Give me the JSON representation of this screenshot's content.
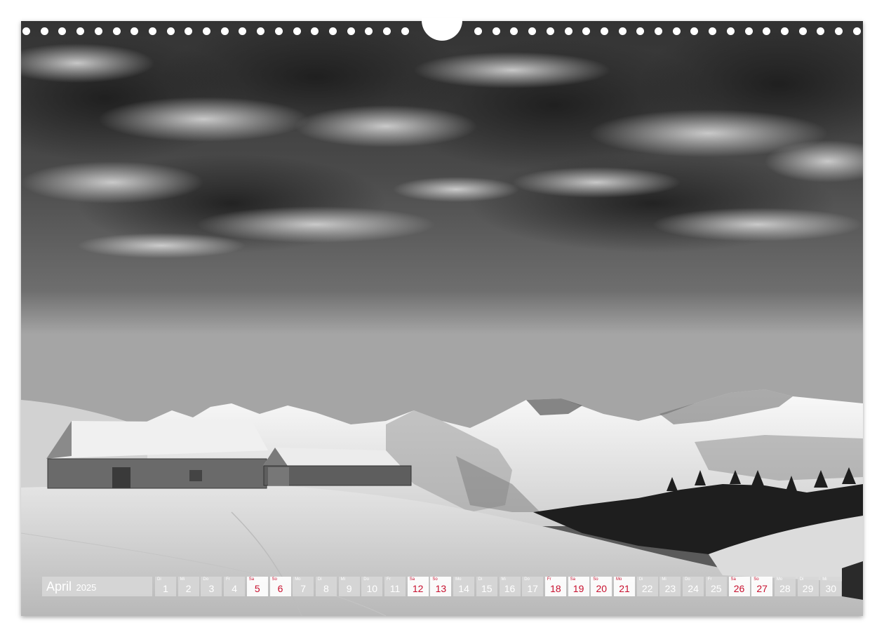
{
  "calendar": {
    "month": "April",
    "year": "2025",
    "colors": {
      "weekday_text": "#ffffff",
      "holiday_text": "#c8102e",
      "cell_bg": "#d7d7d7"
    },
    "days": [
      {
        "num": "1",
        "abbr": "Di",
        "red": false
      },
      {
        "num": "2",
        "abbr": "Mi",
        "red": false
      },
      {
        "num": "3",
        "abbr": "Do",
        "red": false
      },
      {
        "num": "4",
        "abbr": "Fr",
        "red": false
      },
      {
        "num": "5",
        "abbr": "Sa",
        "red": true
      },
      {
        "num": "6",
        "abbr": "So",
        "red": true
      },
      {
        "num": "7",
        "abbr": "Mo",
        "red": false
      },
      {
        "num": "8",
        "abbr": "Di",
        "red": false
      },
      {
        "num": "9",
        "abbr": "Mi",
        "red": false
      },
      {
        "num": "10",
        "abbr": "Do",
        "red": false
      },
      {
        "num": "11",
        "abbr": "Fr",
        "red": false
      },
      {
        "num": "12",
        "abbr": "Sa",
        "red": true
      },
      {
        "num": "13",
        "abbr": "So",
        "red": true
      },
      {
        "num": "14",
        "abbr": "Mo",
        "red": false
      },
      {
        "num": "15",
        "abbr": "Di",
        "red": false
      },
      {
        "num": "16",
        "abbr": "Mi",
        "red": false
      },
      {
        "num": "17",
        "abbr": "Do",
        "red": false
      },
      {
        "num": "18",
        "abbr": "Fr",
        "red": true
      },
      {
        "num": "19",
        "abbr": "Sa",
        "red": true
      },
      {
        "num": "20",
        "abbr": "So",
        "red": true
      },
      {
        "num": "21",
        "abbr": "Mo",
        "red": true
      },
      {
        "num": "22",
        "abbr": "Di",
        "red": false
      },
      {
        "num": "23",
        "abbr": "Mi",
        "red": false
      },
      {
        "num": "24",
        "abbr": "Do",
        "red": false
      },
      {
        "num": "25",
        "abbr": "Fr",
        "red": false
      },
      {
        "num": "26",
        "abbr": "Sa",
        "red": true
      },
      {
        "num": "27",
        "abbr": "So",
        "red": true
      },
      {
        "num": "28",
        "abbr": "Mo",
        "red": false
      },
      {
        "num": "29",
        "abbr": "Di",
        "red": false
      },
      {
        "num": "30",
        "abbr": "Mi",
        "red": false
      }
    ]
  },
  "photo": {
    "subject": "monochrome-alpine-winter-landscape",
    "colors": {
      "sky_top": "#3a3a3a",
      "sky_bottom": "#9a9a9a",
      "snow": "#f2f2f2",
      "forest": "#1e1e1e"
    }
  },
  "binding": {
    "hole_icon": "binding-hole-icon",
    "hanger_icon": "hanger-notch-icon"
  }
}
